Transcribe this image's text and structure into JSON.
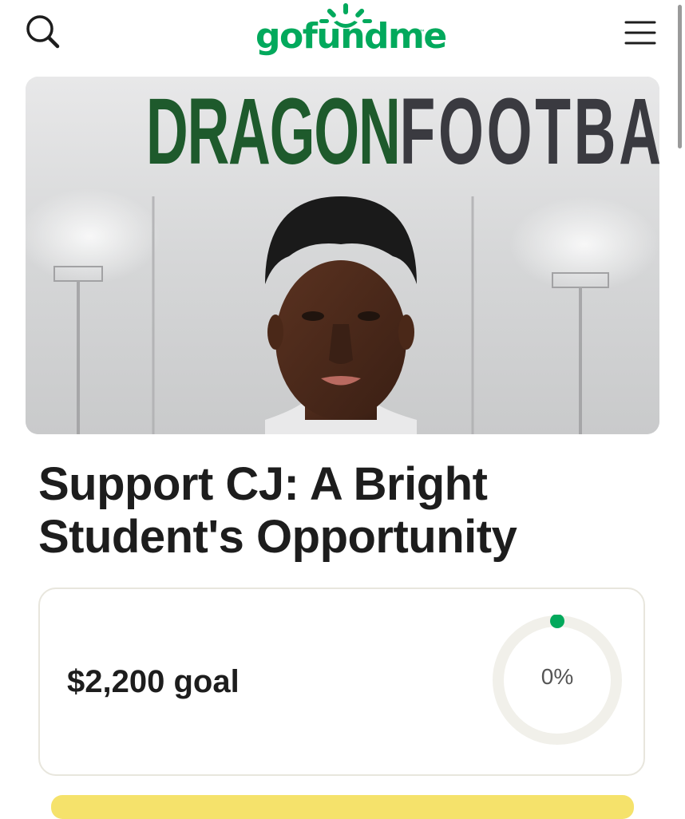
{
  "header": {
    "brand_name": "gofundme",
    "brand_tm": "™",
    "brand_color": "#02a95c",
    "search_icon": "search-icon",
    "menu_icon": "hamburger-menu-icon"
  },
  "hero": {
    "brand_part_1": "DRAGON",
    "brand_part_2": "FOOTBALL",
    "colors": {
      "dragon": "#1e5a2c",
      "football": "#3a3a40"
    }
  },
  "campaign": {
    "title": "Support CJ: A Bright Student's Opportunity"
  },
  "progress": {
    "goal_label": "$2,200 goal",
    "percent_label": "0%",
    "percent_value": 0,
    "accent_color": "#02a95c",
    "track_color": "#f1f0ea"
  },
  "footer": {
    "cta_color": "#f5e26b"
  }
}
